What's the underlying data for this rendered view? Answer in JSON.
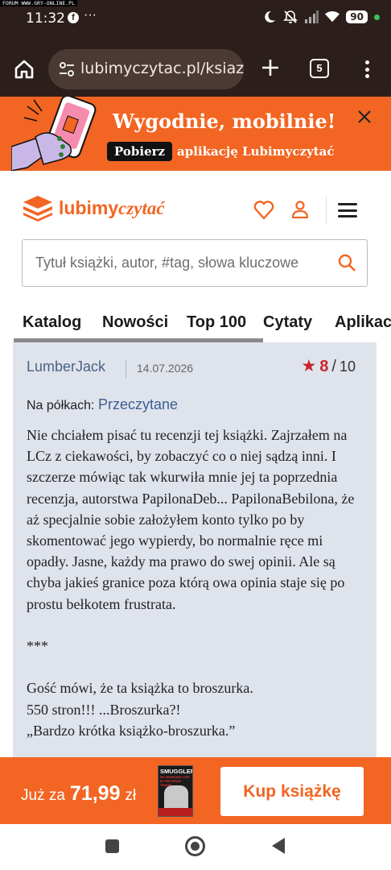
{
  "watermark": "FORUM WWW.GRY-ONLINE.PL",
  "status_bar": {
    "time": "11:32",
    "battery": "90"
  },
  "browser": {
    "url": "lubimyczytac.pl/ksiazk",
    "tab_count": "5"
  },
  "app_banner": {
    "title": "Wygodnie, mobilnie!",
    "button": "Pobierz",
    "subtitle": "aplikację Lubimyczytać"
  },
  "site": {
    "logo_part1": "lubimy",
    "logo_part2": "czytać",
    "search_placeholder": "Tytuł książki, autor, #tag, słowa kluczowe"
  },
  "nav_tabs": [
    "Katalog",
    "Nowości",
    "Top 100",
    "Cytaty",
    "Aplikacja"
  ],
  "review": {
    "author": "LumberJack",
    "date": "14.07.2026",
    "rating": "8",
    "rating_max": "10",
    "shelves_label": "Na półkach:",
    "shelf": "Przeczytane",
    "paragraph1": "Nie chciałem pisać tu recenzji tej książki. Zajrzałem na LCz z ciekawości, by zobaczyć co o niej sądzą inni. I szczerze mówiąc tak wkurwiła mnie jej ta poprzednia recenzja, autorstwa PapilonaDeb... PapilonaBebilona, że aż specjalnie sobie założyłem konto tylko po by skomentować jego wypierdy, bo normalnie ręce mi opadły. Jasne, każdy ma prawo do swej opinii. Ale są chyba jakieś granice poza którą owa opinia staje się po prostu bełkotem frustrata.",
    "separator": "***",
    "line1": "Gość mówi, że ta książka to broszurka.",
    "line2": "550 stron!!! ...Broszurka?!",
    "line3": "„Bardzo krótka książko-broszurka.”"
  },
  "buy_bar": {
    "price_prefix": "Już za",
    "price": "71,99",
    "currency": "zł",
    "cover_title": "SMUGGLER",
    "cover_subtitle": "MY WORKING LIFE IN THE DRUG TRADE",
    "button": "Kup książkę"
  },
  "colors": {
    "brand_orange": "#f26522",
    "chrome_bg": "#2c1f1b",
    "card_bg": "#dfe3ec",
    "rating_red": "#c8262c",
    "link_blue": "#3c5f90"
  }
}
